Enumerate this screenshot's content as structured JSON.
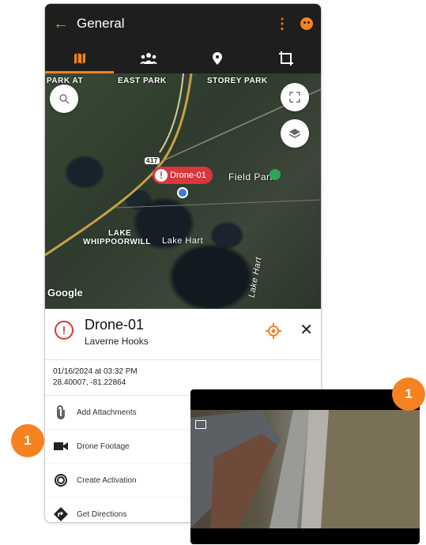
{
  "app": {
    "title": "General"
  },
  "tabs": [
    {
      "icon": "map-icon",
      "active": true
    },
    {
      "icon": "people-icon",
      "active": false
    },
    {
      "icon": "location-pin-icon",
      "active": false
    },
    {
      "icon": "square-frame-icon",
      "active": false
    }
  ],
  "map": {
    "labels": [
      "PARK AT",
      "EAST PARK",
      "STOREY PARK",
      "Field Park",
      "LAKE",
      "WHIPPOORWILL",
      "Lake Hart",
      "Lake Hart",
      "Google"
    ],
    "road_shield": "417",
    "marker_label": "Drone-01"
  },
  "detail": {
    "name": "Drone-01",
    "user": "Laverne Hooks",
    "datetime": "01/16/2024 at 03:32 PM",
    "coords": "28.40007, -81.22864"
  },
  "actions": [
    {
      "label": "Add Attachments",
      "icon": "paperclip-icon"
    },
    {
      "label": "Drone Footage",
      "icon": "video-camera-icon"
    },
    {
      "label": "Create Activation",
      "icon": "target-circle-icon"
    },
    {
      "label": "Get Directions",
      "icon": "directions-icon"
    }
  ],
  "callouts": {
    "left": "1",
    "right": "1"
  },
  "colors": {
    "accent": "#f58220",
    "alert": "#d9363e",
    "bar": "#1e1e1e"
  }
}
